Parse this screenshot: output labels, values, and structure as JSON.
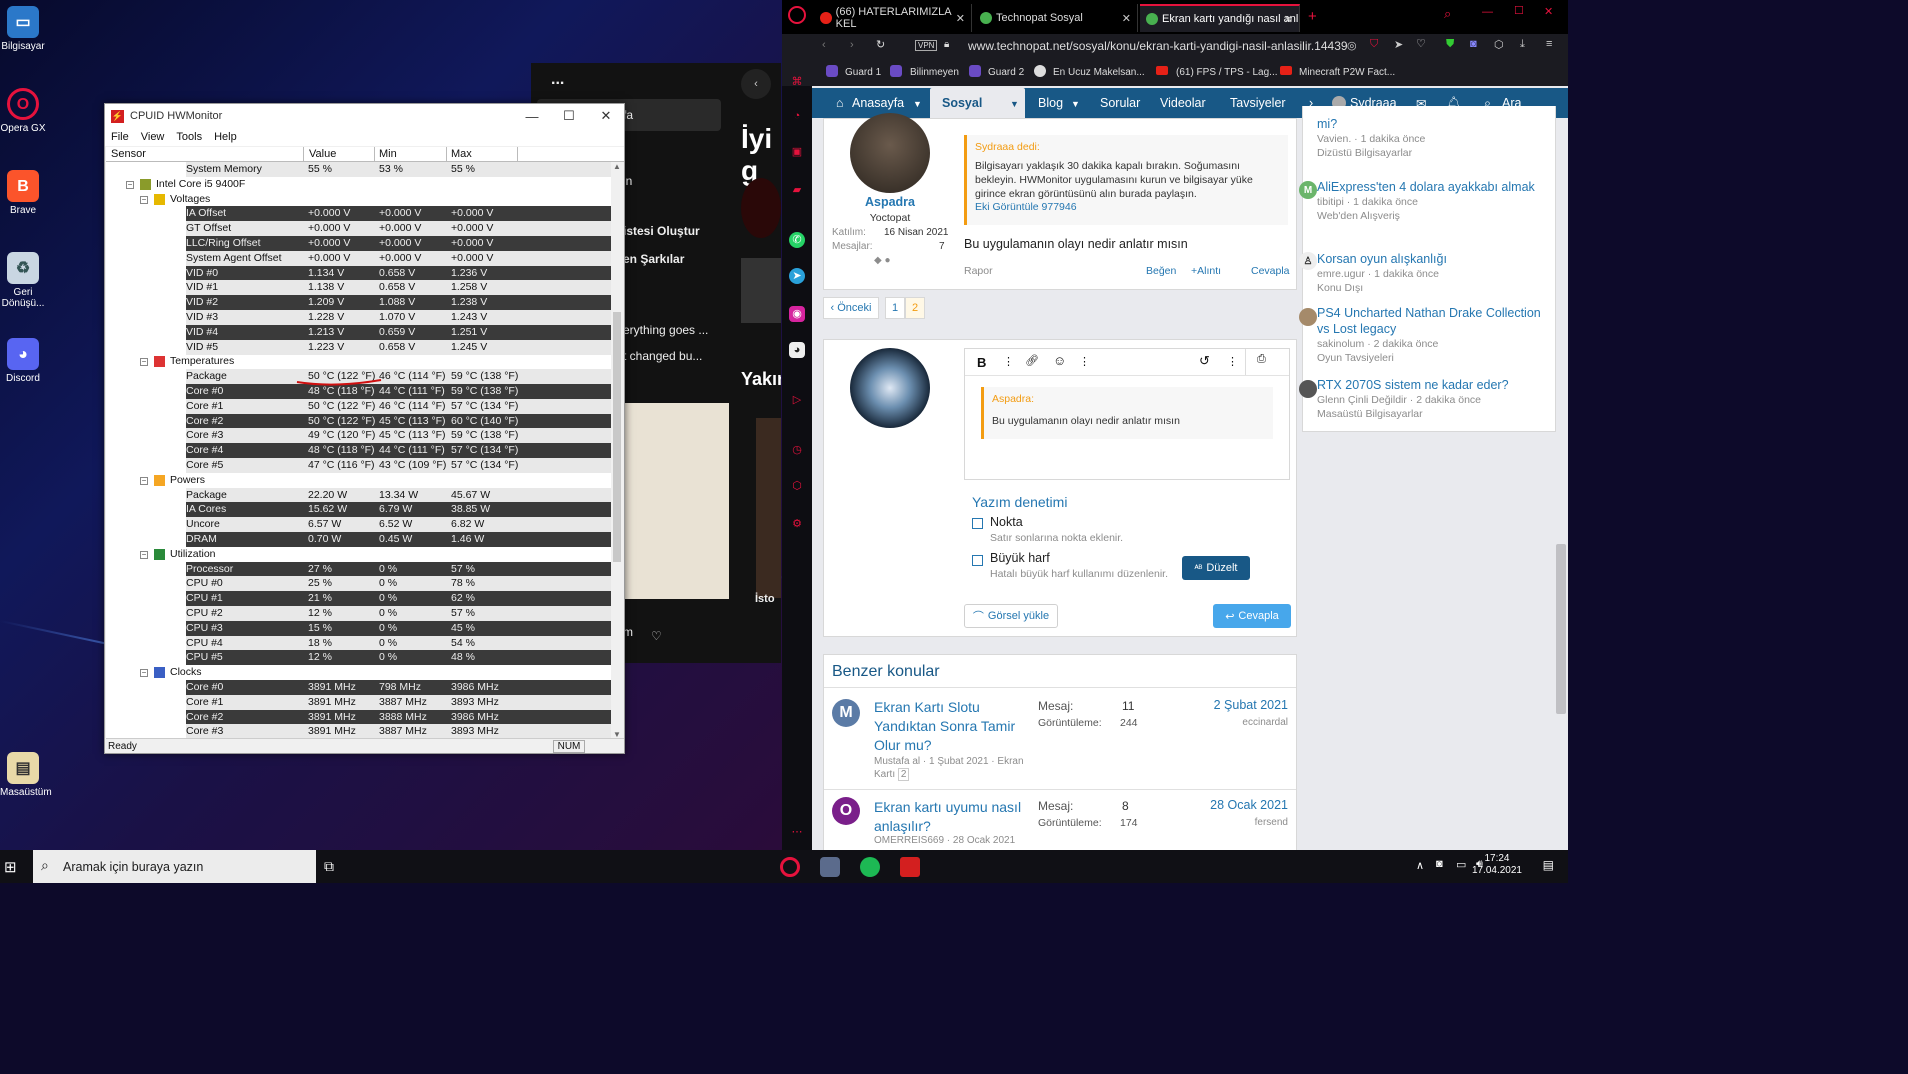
{
  "desktop": {
    "icons": [
      {
        "label": "Bilgisayar",
        "icon": "computer-icon"
      },
      {
        "label": "Opera GX",
        "icon": "opera-gx-icon"
      },
      {
        "label": "Brave",
        "icon": "brave-icon"
      },
      {
        "label": "Geri Dönüşü...",
        "icon": "recycle-bin-icon"
      },
      {
        "label": "Discord",
        "icon": "discord-icon"
      },
      {
        "label": "Masaüstüm",
        "icon": "folder-icon"
      }
    ]
  },
  "media": {
    "dots": "...",
    "heading1": "İyi g",
    "heading2": "Yakın",
    "items": [
      "fa",
      "in",
      "istesi Oluştur",
      "en Şarkılar",
      "erything goes ...",
      "t changed bu...",
      "m",
      "İsto"
    ]
  },
  "hwmonitor": {
    "title": "CPUID HWMonitor",
    "menu": [
      "File",
      "View",
      "Tools",
      "Help"
    ],
    "columns": [
      "Sensor",
      "Value",
      "Min",
      "Max"
    ],
    "status": "Ready",
    "num": "NUM",
    "rows": [
      {
        "type": "item",
        "name": "System Memory",
        "value": "55 %",
        "min": "53 %",
        "max": "55 %"
      },
      {
        "type": "group1",
        "name": "Intel Core i5 9400F"
      },
      {
        "type": "group2",
        "name": "Voltages"
      },
      {
        "type": "item",
        "name": "IA Offset",
        "value": "+0.000 V",
        "min": "+0.000 V",
        "max": "+0.000 V"
      },
      {
        "type": "item",
        "name": "GT Offset",
        "value": "+0.000 V",
        "min": "+0.000 V",
        "max": "+0.000 V"
      },
      {
        "type": "item",
        "name": "LLC/Ring Offset",
        "value": "+0.000 V",
        "min": "+0.000 V",
        "max": "+0.000 V"
      },
      {
        "type": "item",
        "name": "System Agent Offset",
        "value": "+0.000 V",
        "min": "+0.000 V",
        "max": "+0.000 V"
      },
      {
        "type": "item",
        "name": "VID #0",
        "value": "1.134 V",
        "min": "0.658 V",
        "max": "1.236 V"
      },
      {
        "type": "item",
        "name": "VID #1",
        "value": "1.138 V",
        "min": "0.658 V",
        "max": "1.258 V"
      },
      {
        "type": "item",
        "name": "VID #2",
        "value": "1.209 V",
        "min": "1.088 V",
        "max": "1.238 V"
      },
      {
        "type": "item",
        "name": "VID #3",
        "value": "1.228 V",
        "min": "1.070 V",
        "max": "1.243 V"
      },
      {
        "type": "item",
        "name": "VID #4",
        "value": "1.213 V",
        "min": "0.659 V",
        "max": "1.251 V"
      },
      {
        "type": "item",
        "name": "VID #5",
        "value": "1.223 V",
        "min": "0.658 V",
        "max": "1.245 V"
      },
      {
        "type": "group2",
        "name": "Temperatures"
      },
      {
        "type": "item",
        "name": "Package",
        "value": "50 °C  (122 °F)",
        "min": "46 °C  (114 °F)",
        "max": "59 °C  (138 °F)"
      },
      {
        "type": "item",
        "name": "Core #0",
        "value": "48 °C  (118 °F)",
        "min": "44 °C  (111 °F)",
        "max": "59 °C  (138 °F)"
      },
      {
        "type": "item",
        "name": "Core #1",
        "value": "50 °C  (122 °F)",
        "min": "46 °C  (114 °F)",
        "max": "57 °C  (134 °F)"
      },
      {
        "type": "item",
        "name": "Core #2",
        "value": "50 °C  (122 °F)",
        "min": "45 °C  (113 °F)",
        "max": "60 °C  (140 °F)"
      },
      {
        "type": "item",
        "name": "Core #3",
        "value": "49 °C  (120 °F)",
        "min": "45 °C  (113 °F)",
        "max": "59 °C  (138 °F)"
      },
      {
        "type": "item",
        "name": "Core #4",
        "value": "48 °C  (118 °F)",
        "min": "44 °C  (111 °F)",
        "max": "57 °C  (134 °F)"
      },
      {
        "type": "item",
        "name": "Core #5",
        "value": "47 °C  (116 °F)",
        "min": "43 °C  (109 °F)",
        "max": "57 °C  (134 °F)"
      },
      {
        "type": "group2",
        "name": "Powers"
      },
      {
        "type": "item",
        "name": "Package",
        "value": "22.20 W",
        "min": "13.34 W",
        "max": "45.67 W"
      },
      {
        "type": "item",
        "name": "IA Cores",
        "value": "15.62 W",
        "min": "6.79 W",
        "max": "38.85 W"
      },
      {
        "type": "item",
        "name": "Uncore",
        "value": "6.57 W",
        "min": "6.52 W",
        "max": "6.82 W"
      },
      {
        "type": "item",
        "name": "DRAM",
        "value": "0.70 W",
        "min": "0.45 W",
        "max": "1.46 W"
      },
      {
        "type": "group2",
        "name": "Utilization"
      },
      {
        "type": "item",
        "name": "Processor",
        "value": "27 %",
        "min": "0 %",
        "max": "57 %"
      },
      {
        "type": "item",
        "name": "CPU #0",
        "value": "25 %",
        "min": "0 %",
        "max": "78 %"
      },
      {
        "type": "item",
        "name": "CPU #1",
        "value": "21 %",
        "min": "0 %",
        "max": "62 %"
      },
      {
        "type": "item",
        "name": "CPU #2",
        "value": "12 %",
        "min": "0 %",
        "max": "57 %"
      },
      {
        "type": "item",
        "name": "CPU #3",
        "value": "15 %",
        "min": "0 %",
        "max": "45 %"
      },
      {
        "type": "item",
        "name": "CPU #4",
        "value": "18 %",
        "min": "0 %",
        "max": "54 %"
      },
      {
        "type": "item",
        "name": "CPU #5",
        "value": "12 %",
        "min": "0 %",
        "max": "48 %"
      },
      {
        "type": "group2",
        "name": "Clocks"
      },
      {
        "type": "item",
        "name": "Core #0",
        "value": "3891 MHz",
        "min": "798 MHz",
        "max": "3986 MHz"
      },
      {
        "type": "item",
        "name": "Core #1",
        "value": "3891 MHz",
        "min": "3887 MHz",
        "max": "3893 MHz"
      },
      {
        "type": "item",
        "name": "Core #2",
        "value": "3891 MHz",
        "min": "3888 MHz",
        "max": "3986 MHz"
      },
      {
        "type": "item",
        "name": "Core #3",
        "value": "3891 MHz",
        "min": "3887 MHz",
        "max": "3893 MHz"
      }
    ]
  },
  "browser": {
    "tabs": [
      {
        "label": "(66) HATERLARIMIZLA KEL",
        "fav": "#e62117"
      },
      {
        "label": "Technopat Sosyal",
        "fav": "#48b04f"
      },
      {
        "label": "Ekran kartı yandığı nasıl anl",
        "fav": "#48b04f"
      }
    ],
    "url": "www.technopat.net/sosyal/konu/ekran-karti-yandigi-nasil-anlasilir.14439",
    "vpn": "VPN",
    "bookmarks": [
      "Guard 1",
      "Bilinmeyen",
      "Guard 2",
      "En Ucuz Makelsan...",
      "(61) FPS / TPS - Lag...",
      "Minecraft P2W Fact..."
    ],
    "nav": {
      "items": [
        "Anasayfa",
        "Sosyal",
        "Blog",
        "Sorular",
        "Videolar",
        "Tavsiyeler"
      ],
      "user": "Sydraaa",
      "search": "Ara"
    }
  },
  "post": {
    "author": "Aspadra",
    "role": "Yoctopat",
    "joined_label": "Katılım:",
    "joined": "16 Nisan 2021",
    "messages_label": "Mesajlar:",
    "messages": "7",
    "quote_author": "Sydraaa dedi:",
    "quote_text": "Bilgisayarı yaklaşık 30 dakika kapalı bırakın. Soğumasını bekleyin. HWMonitor uygulamasını kurun ve bilgisayar yüke girince ekran görüntüsünü alın burada paylaşın.",
    "quote_link": "Eki Görüntüle 977946",
    "body": "Bu uygulamanın olayı nedir anlatır mısın",
    "report": "Rapor",
    "like": "Beğen",
    "quote_btn": "+Alıntı",
    "reply_btn": "Cevapla"
  },
  "pagination": {
    "prev": "‹ Önceki",
    "pages": [
      "1",
      "2"
    ]
  },
  "editor": {
    "quote_author": "Aspadra:",
    "quote_text": "Bu uygulamanın olayı nedir anlatır mısın",
    "spell_title": "Yazım denetimi",
    "opt1_label": "Nokta",
    "opt1_desc": "Satır sonlarına nokta eklenir.",
    "opt2_label": "Büyük harf",
    "opt2_desc": "Hatalı büyük harf kullanımı düzenlenir.",
    "fix_btn": "Düzelt",
    "upload_btn": "Görsel yükle",
    "reply_btn": "Cevapla"
  },
  "similar": {
    "title": "Benzer konular",
    "items": [
      {
        "title": "Ekran Kartı Slotu Yandıktan Sonra Tamir Olur mu?",
        "meta": "Mustafa al · 1 Şubat 2021 · Ekran Kartı",
        "page": "2",
        "msg_label": "Mesaj:",
        "msgs": "11",
        "view_label": "Görüntüleme:",
        "views": "244",
        "date": "2 Şubat 2021",
        "user": "eccinardal",
        "avatar": "M",
        "color": "#5b7ba6"
      },
      {
        "title": "Ekran kartı uyumu nasıl anlaşılır?",
        "meta": "OMERREIS669 · 28 Ocak 2021",
        "msg_label": "Mesaj:",
        "msgs": "8",
        "view_label": "Görüntüleme:",
        "views": "174",
        "date": "28 Ocak 2021",
        "user": "fersend",
        "avatar": "O",
        "color": "#7a1f8a"
      }
    ]
  },
  "activity": [
    {
      "title": "mi?",
      "meta1": "Vavien. · 1 dakika önce",
      "meta2": "Dizüstü Bilgisayarlar"
    },
    {
      "title": "AliExpress'ten 4 dolara ayakkabı almak",
      "meta1": "tibitipi · 1 dakika önce",
      "meta2": "Web'den Alışveriş"
    },
    {
      "title": "Korsan oyun alışkanlığı",
      "meta1": "emre.ugur · 1 dakika önce",
      "meta2": "Konu Dışı"
    },
    {
      "title": "PS4 Uncharted Nathan Drake Collection vs Lost legacy",
      "meta1": "sakinolum · 2 dakika önce",
      "meta2": "Oyun Tavsiyeleri"
    },
    {
      "title": "RTX 2070S sistem ne kadar eder?",
      "meta1": "Glenn Çinli Değildir · 2 dakika önce",
      "meta2": "Masaüstü Bilgisayarlar"
    }
  ],
  "taskbar": {
    "search_placeholder": "Aramak için buraya yazın",
    "time": "17:24",
    "date": "17.04.2021"
  }
}
